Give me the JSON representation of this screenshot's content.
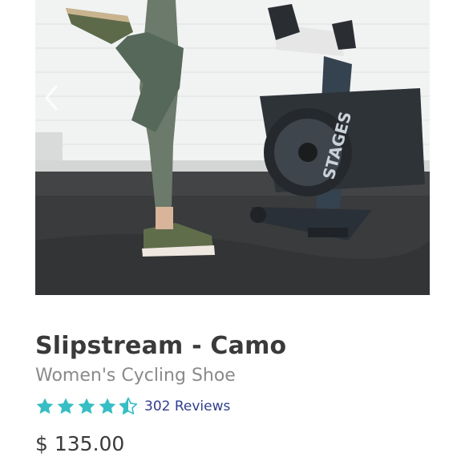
{
  "product": {
    "image_alt": "Woman in camo leggings and cycling shoes standing next to a stationary bike",
    "bike_brand": "STAGES",
    "name": "Slipstream - Camo",
    "subtitle": "Women's Cycling Shoe",
    "rating": 4.5,
    "rating_max": 5,
    "reviews_label": "302 Reviews",
    "price": "$ 135.00"
  },
  "colors": {
    "title": "#3a3a3a",
    "subtitle": "#8a8a8a",
    "star": "#36bec4",
    "reviews_link": "#2f3e8e"
  },
  "icons": {
    "carousel_prev": "chevron-left-icon",
    "star_full": "star-icon",
    "star_half": "star-half-icon"
  }
}
